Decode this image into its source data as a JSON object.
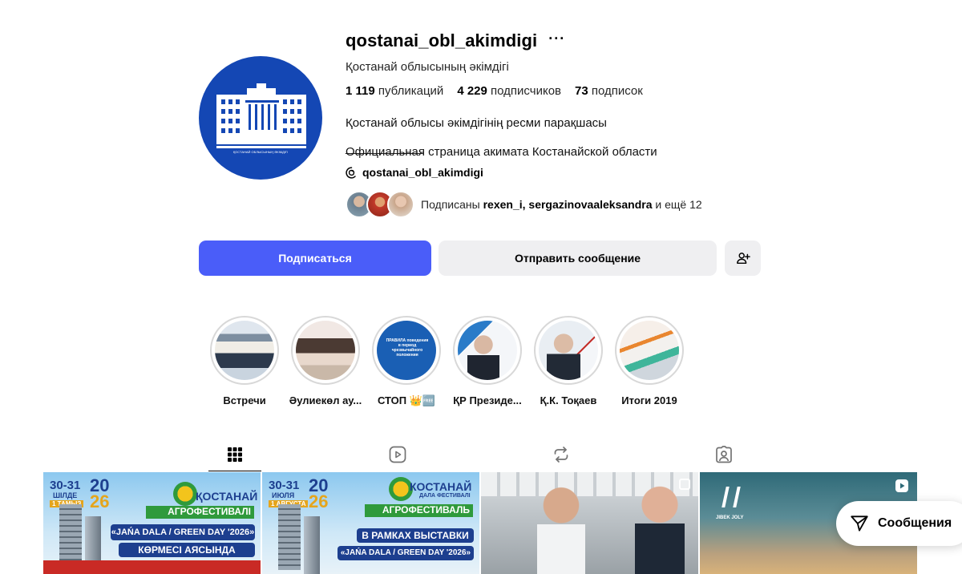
{
  "profile": {
    "username": "qostanai_obl_akimdigi",
    "more": "···",
    "full_name": "Қостанай облысының әкімдігі",
    "stats": [
      {
        "value": "1 119",
        "label": "публикаций"
      },
      {
        "value": "4 229",
        "label": "подписчиков"
      },
      {
        "value": "73",
        "label": "подписок"
      }
    ],
    "bio_kz": "Қостанай облысы әкімдігінің ресми парақшасы",
    "bio_separator": "_____________",
    "bio_ru": "Официальная страница акимата Костанайской области",
    "threads_handle": "qostanai_obl_akimdigi",
    "followed_by": {
      "prefix": "Подписаны",
      "names": "rexen_i, sergazinovaaleksandra",
      "suffix": "и ещё 12"
    }
  },
  "buttons": {
    "follow": "Подписаться",
    "message": "Отправить сообщение"
  },
  "highlights": [
    {
      "label": "Встречи"
    },
    {
      "label": "Әулиекөл ау..."
    },
    {
      "label": "СТОП 👑🆓"
    },
    {
      "label": "ҚР Президе..."
    },
    {
      "label": "Қ.К. Тоқаев"
    },
    {
      "label": "Итоги 2019"
    }
  ],
  "highlight_texts": {
    "stop_card": "ПРАВИЛА поведения в период чрезвычайного положения"
  },
  "tabs": [
    {
      "name": "posts",
      "icon": "grid-icon",
      "active": true
    },
    {
      "name": "reels",
      "icon": "reels-icon",
      "active": false
    },
    {
      "name": "reposts",
      "icon": "repost-icon",
      "active": false
    },
    {
      "name": "tagged",
      "icon": "tagged-icon",
      "active": false
    }
  ],
  "posts": {
    "p1": {
      "dates": "30-31",
      "month": "ШІЛДЕ",
      "month2": "1 ТАМЫЗ",
      "year_a": "20",
      "year_b": "26",
      "city": "ҚОСТАНАЙ",
      "fest": "АГРОФЕСТИВАЛІ",
      "line1": "«JAŃA DALA / GREEN DAY '2026»",
      "line2": "КӨРМЕСІ АЯСЫНДА"
    },
    "p2": {
      "dates": "30-31",
      "month": "ИЮЛЯ",
      "month2": "1 АВГУСТА",
      "year_a": "20",
      "year_b": "26",
      "city": "КОСТАНАЙ",
      "city_sub": "ДАЛА ФЕСТИВАЛІ",
      "fest": "АГРОФЕСТИВАЛЬ",
      "line1": "В РАМКАХ ВЫСТАВКИ",
      "line2": "«JAŃA DALA / GREEN DAY '2026»"
    },
    "p4": {
      "logo": "JIBEK JOLY"
    }
  },
  "floating": {
    "messages": "Сообщения"
  },
  "colors": {
    "accent": "#4a5df9",
    "avatar_bg": "#1447b4",
    "button_bg": "#efeff1"
  }
}
